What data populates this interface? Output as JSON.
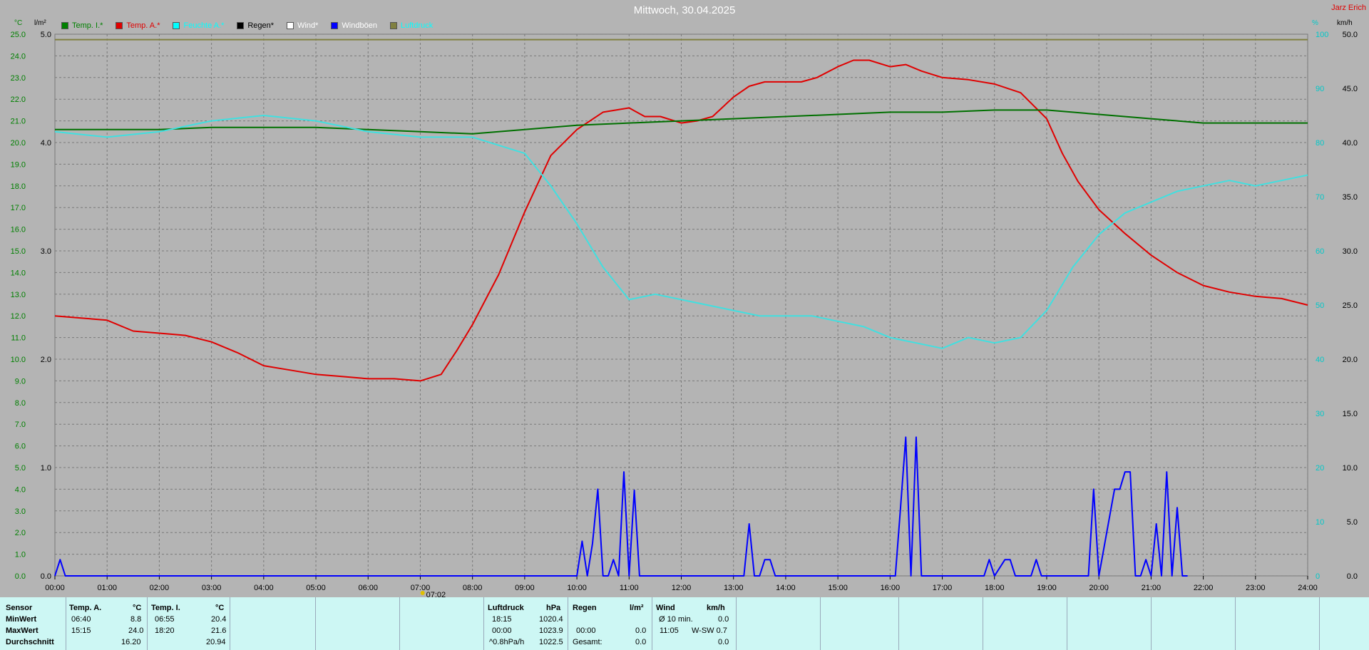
{
  "header": {
    "title": "Mittwoch, 30.04.2025",
    "author": "Jarz Erich"
  },
  "units": {
    "left1": "°C",
    "left2": "l/m²",
    "right1": "%",
    "right2": "km/h"
  },
  "legend": [
    {
      "label": "Temp. I.*",
      "color": "#008000"
    },
    {
      "label": "Temp. A.*",
      "color": "#e00000"
    },
    {
      "label": "Feuchte A.*",
      "color": "#00ffff"
    },
    {
      "label": "Regen*",
      "color": "#000000"
    },
    {
      "label": "Wind*",
      "color": "#ffffff"
    },
    {
      "label": "Windböen",
      "color": "#0000ff"
    },
    {
      "label": "Luftdruck",
      "color": "#808040"
    }
  ],
  "chart_data": {
    "type": "line",
    "x_ticks": [
      "00:00",
      "01:00",
      "02:00",
      "03:00",
      "04:00",
      "05:00",
      "06:00",
      "07:00",
      "08:00",
      "09:00",
      "10:00",
      "11:00",
      "12:00",
      "13:00",
      "14:00",
      "15:00",
      "16:00",
      "17:00",
      "18:00",
      "19:00",
      "20:00",
      "21:00",
      "22:00",
      "23:00",
      "24:00"
    ],
    "sunrise_label": "07:02",
    "axes": {
      "temp": {
        "ylim": [
          0,
          25
        ],
        "ticks": [
          "0.0",
          "1.0",
          "2.0",
          "3.0",
          "4.0",
          "5.0",
          "6.0",
          "7.0",
          "8.0",
          "9.0",
          "10.0",
          "11.0",
          "12.0",
          "13.0",
          "14.0",
          "15.0",
          "16.0",
          "17.0",
          "18.0",
          "19.0",
          "20.0",
          "21.0",
          "22.0",
          "23.0",
          "24.0",
          "25.0"
        ]
      },
      "rain": {
        "ylim": [
          0,
          5
        ],
        "ticks": [
          "0.0",
          "1.0",
          "2.0",
          "3.0",
          "4.0",
          "5.0"
        ]
      },
      "humidity": {
        "ylim": [
          0,
          100
        ],
        "ticks": [
          "0",
          "10",
          "20",
          "30",
          "40",
          "50",
          "60",
          "70",
          "80",
          "90",
          "100"
        ]
      },
      "wind": {
        "ylim": [
          0,
          50
        ],
        "ticks": [
          "0.0",
          "5.0",
          "10.0",
          "15.0",
          "20.0",
          "25.0",
          "30.0",
          "35.0",
          "40.0",
          "45.0",
          "50.0"
        ]
      }
    },
    "grid": true,
    "series": [
      {
        "name": "Temp. A.*",
        "axis": "temp",
        "color": "#e00000",
        "x": [
          0,
          0.5,
          1,
          1.5,
          2,
          2.5,
          3,
          3.5,
          4,
          4.5,
          5,
          5.5,
          6,
          6.5,
          7,
          7.4,
          7.7,
          8,
          8.5,
          9,
          9.5,
          10,
          10.5,
          11,
          11.3,
          11.6,
          12,
          12.3,
          12.6,
          13,
          13.3,
          13.6,
          14,
          14.3,
          14.6,
          15,
          15.3,
          15.6,
          16,
          16.3,
          16.6,
          17,
          17.5,
          18,
          18.5,
          19,
          19.3,
          19.6,
          20,
          20.5,
          21,
          21.5,
          22,
          22.5,
          23,
          23.5,
          24
        ],
        "y": [
          12.0,
          11.9,
          11.8,
          11.3,
          11.2,
          11.1,
          10.8,
          10.3,
          9.7,
          9.5,
          9.3,
          9.2,
          9.1,
          9.1,
          9.0,
          9.3,
          10.4,
          11.6,
          13.9,
          16.8,
          19.4,
          20.6,
          21.4,
          21.6,
          21.2,
          21.2,
          20.9,
          21.0,
          21.2,
          22.1,
          22.6,
          22.8,
          22.8,
          22.8,
          23.0,
          23.5,
          23.8,
          23.8,
          23.5,
          23.6,
          23.3,
          23.0,
          22.9,
          22.7,
          22.3,
          21.1,
          19.5,
          18.2,
          16.9,
          15.8,
          14.8,
          14.0,
          13.4,
          13.1,
          12.9,
          12.8,
          12.5
        ]
      },
      {
        "name": "Temp. I.*",
        "axis": "temp",
        "color": "#007000",
        "x": [
          0,
          1,
          2,
          3,
          4,
          5,
          6,
          7,
          8,
          9,
          10,
          11,
          12,
          13,
          14,
          15,
          16,
          17,
          18,
          19,
          20,
          21,
          22,
          23,
          24
        ],
        "y": [
          20.6,
          20.6,
          20.6,
          20.7,
          20.7,
          20.7,
          20.6,
          20.5,
          20.4,
          20.6,
          20.8,
          20.9,
          21.0,
          21.1,
          21.2,
          21.3,
          21.4,
          21.4,
          21.5,
          21.5,
          21.3,
          21.1,
          20.9,
          20.9,
          20.9
        ]
      },
      {
        "name": "Feuchte A.*",
        "axis": "humidity",
        "color": "#40e0e0",
        "x": [
          0,
          1,
          2,
          3,
          4,
          5,
          6,
          7,
          8,
          9,
          9.5,
          10,
          10.5,
          11,
          11.5,
          12,
          12.5,
          13,
          13.5,
          14,
          14.5,
          15,
          15.5,
          16,
          16.5,
          17,
          17.5,
          18,
          18.5,
          19,
          19.5,
          20,
          20.5,
          21,
          21.5,
          22,
          22.5,
          23,
          23.5,
          24
        ],
        "y": [
          82,
          81,
          82,
          84,
          85,
          84,
          82,
          81,
          81,
          78,
          72,
          65,
          57,
          51,
          52,
          51,
          50,
          49,
          48,
          48,
          48,
          47,
          46,
          44,
          43,
          42,
          44,
          43,
          44,
          49,
          57,
          63,
          67,
          69,
          71,
          72,
          73,
          72,
          73,
          74
        ]
      },
      {
        "name": "Windböen",
        "axis": "wind",
        "color": "#0000ff",
        "x": [
          0,
          0.1,
          0.2,
          10,
          10.1,
          10.2,
          10.3,
          10.4,
          10.5,
          10.6,
          10.7,
          10.8,
          10.9,
          11.0,
          11.1,
          11.2,
          11.3,
          11.4,
          11.5,
          13.2,
          13.3,
          13.4,
          13.5,
          13.6,
          13.7,
          13.8,
          16.1,
          16.2,
          16.3,
          16.4,
          16.5,
          16.6,
          16.7,
          17.8,
          17.9,
          18.0,
          18.2,
          18.3,
          18.4,
          18.7,
          18.8,
          18.9,
          19.8,
          19.9,
          20.0,
          20.3,
          20.4,
          20.5,
          20.6,
          20.7,
          20.8,
          20.9,
          21.0,
          21.1,
          21.2,
          21.3,
          21.4,
          21.5,
          21.6,
          21.7
        ],
        "y": [
          0,
          1.5,
          0,
          0,
          3.2,
          0,
          3.0,
          8.0,
          0,
          0,
          1.5,
          0,
          9.6,
          0,
          7.9,
          0,
          0,
          0,
          0,
          0,
          4.8,
          0,
          0,
          1.5,
          1.5,
          0,
          0,
          6.3,
          12.8,
          0,
          12.8,
          0,
          0,
          0,
          1.5,
          0,
          1.5,
          1.5,
          0,
          0,
          1.5,
          0,
          0,
          8.0,
          0,
          8.0,
          8.0,
          9.6,
          9.6,
          0,
          0,
          1.5,
          0,
          4.8,
          0,
          9.6,
          0,
          6.3,
          0,
          0
        ]
      },
      {
        "name": "Luftdruck",
        "axis": "humidity",
        "color": "#808040",
        "x": [
          0,
          1,
          2,
          3,
          4,
          5,
          6,
          7,
          8,
          9,
          10,
          11,
          12,
          13,
          14,
          15,
          16,
          17,
          18,
          19,
          20,
          21,
          22,
          23,
          24
        ],
        "y": [
          99,
          99,
          99,
          99,
          99,
          99,
          99,
          99,
          99,
          99,
          99,
          99,
          99,
          99,
          99,
          99,
          99,
          99,
          99,
          99,
          99,
          99,
          99,
          99,
          99
        ]
      }
    ]
  },
  "stats": {
    "sensor": {
      "header": "Sensor",
      "rows": [
        "MinWert",
        "MaxWert",
        "Durchschnitt"
      ]
    },
    "temp_a": {
      "header": "Temp. A.",
      "unit": "°C",
      "min_time": "06:40",
      "min_val": "8.8",
      "max_time": "15:15",
      "max_val": "24.0",
      "avg": "16.20"
    },
    "temp_i": {
      "header": "Temp. I.",
      "unit": "°C",
      "min_time": "06:55",
      "min_val": "20.4",
      "max_time": "18:20",
      "max_val": "21.6",
      "avg": "20.94"
    },
    "pressure": {
      "header": "Luftdruck",
      "unit": "hPa",
      "min_time": "18:15",
      "min_val": "1020.4",
      "max_time": "00:00",
      "max_val": "1023.9",
      "trend_label": "^0.8hPa/h",
      "trend_val": "1022.5"
    },
    "rain": {
      "header": "Regen",
      "unit": "l/m²",
      "time": "00:00",
      "val": "0.0",
      "total_label": "Gesamt:",
      "total_val": "0.0"
    },
    "wind": {
      "header": "Wind",
      "unit": "km/h",
      "avg_label": "Ø 10 min.",
      "avg_val": "0.0",
      "max_time": "11:05",
      "max_val": "W-SW 0.7",
      "avg2_val": "0.0"
    }
  }
}
